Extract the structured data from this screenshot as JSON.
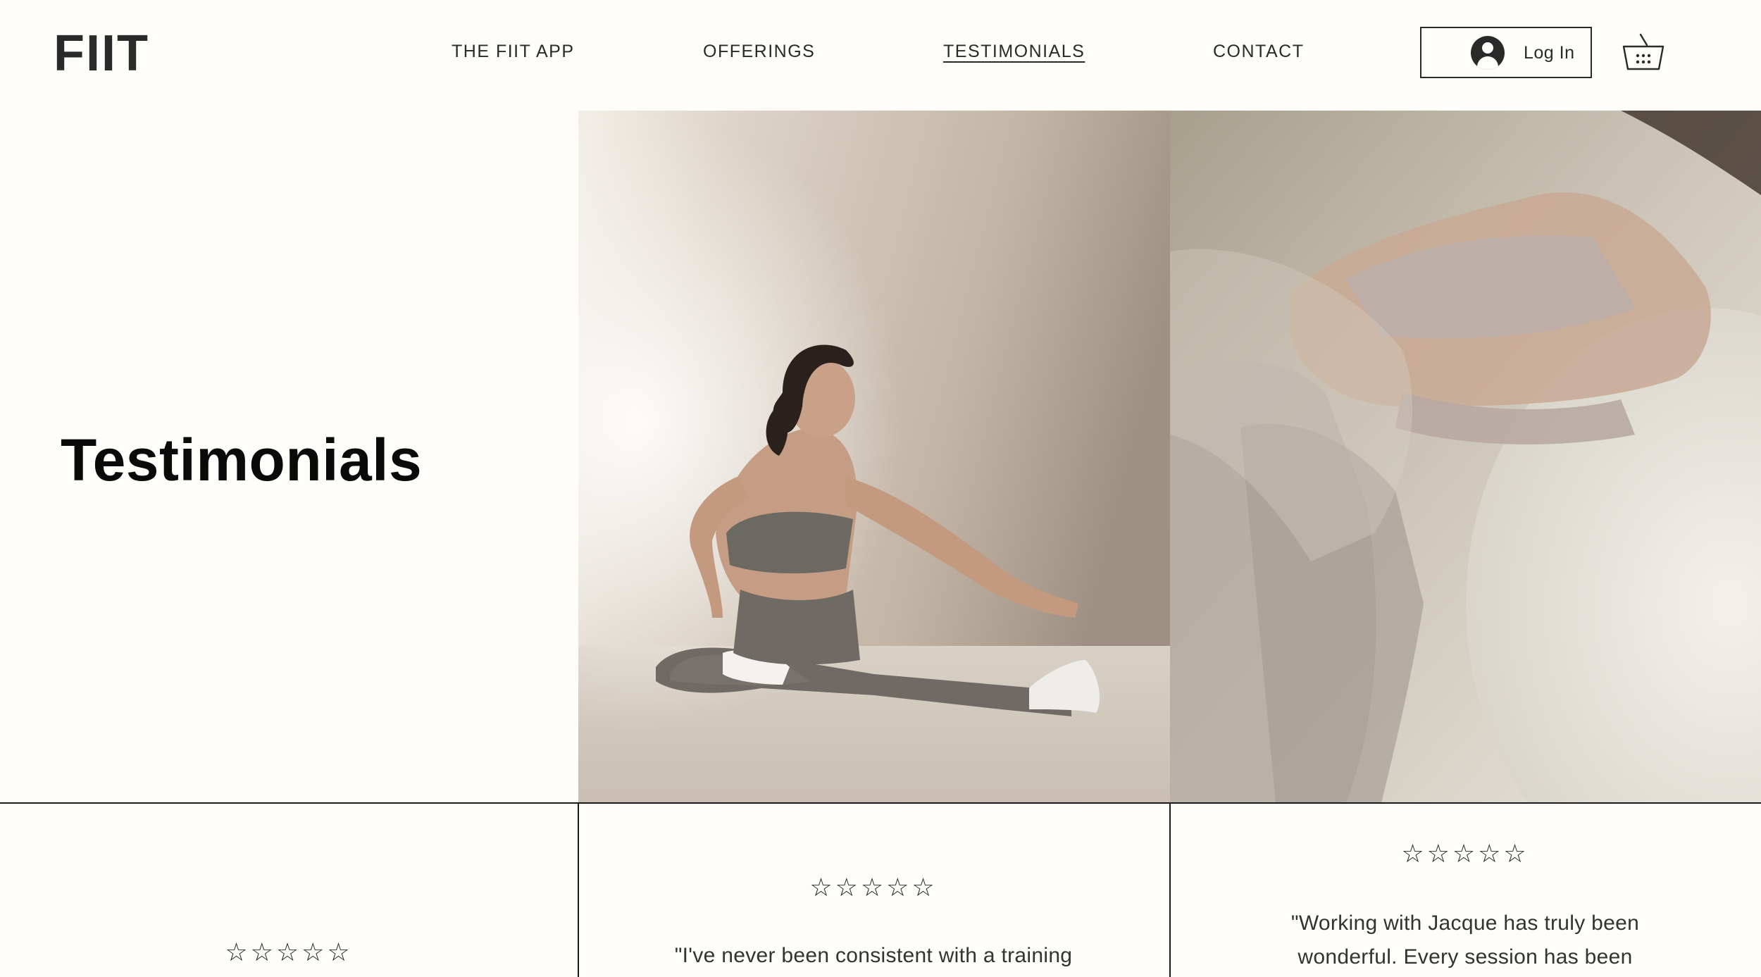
{
  "brand": {
    "logo": "FIIT"
  },
  "nav": {
    "items": [
      {
        "label": "THE FIIT APP",
        "active": false
      },
      {
        "label": "OFFERINGS",
        "active": false
      },
      {
        "label": "TESTIMONIALS",
        "active": true
      },
      {
        "label": "CONTACT",
        "active": false
      }
    ],
    "login_label": "Log In",
    "cart_icon": "basket-icon",
    "avatar_icon": "user-avatar-icon"
  },
  "hero": {
    "title": "Testimonials",
    "image_left_alt": "woman-stretching-photo",
    "image_right_alt": "woman-exercise-ball-photo"
  },
  "testimonials": [
    {
      "rating": "☆☆☆☆☆",
      "stars": 5,
      "quote": ""
    },
    {
      "rating": "☆☆☆☆☆",
      "stars": 5,
      "quote": "\"I've never been consistent with a training"
    },
    {
      "rating": "☆☆☆☆☆",
      "stars": 5,
      "quote": "\"Working with Jacque has truly been wonderful. Every session has been"
    }
  ],
  "colors": {
    "background": "#fefdf9",
    "text": "#2a2a2a",
    "border": "#1a1a1a"
  }
}
